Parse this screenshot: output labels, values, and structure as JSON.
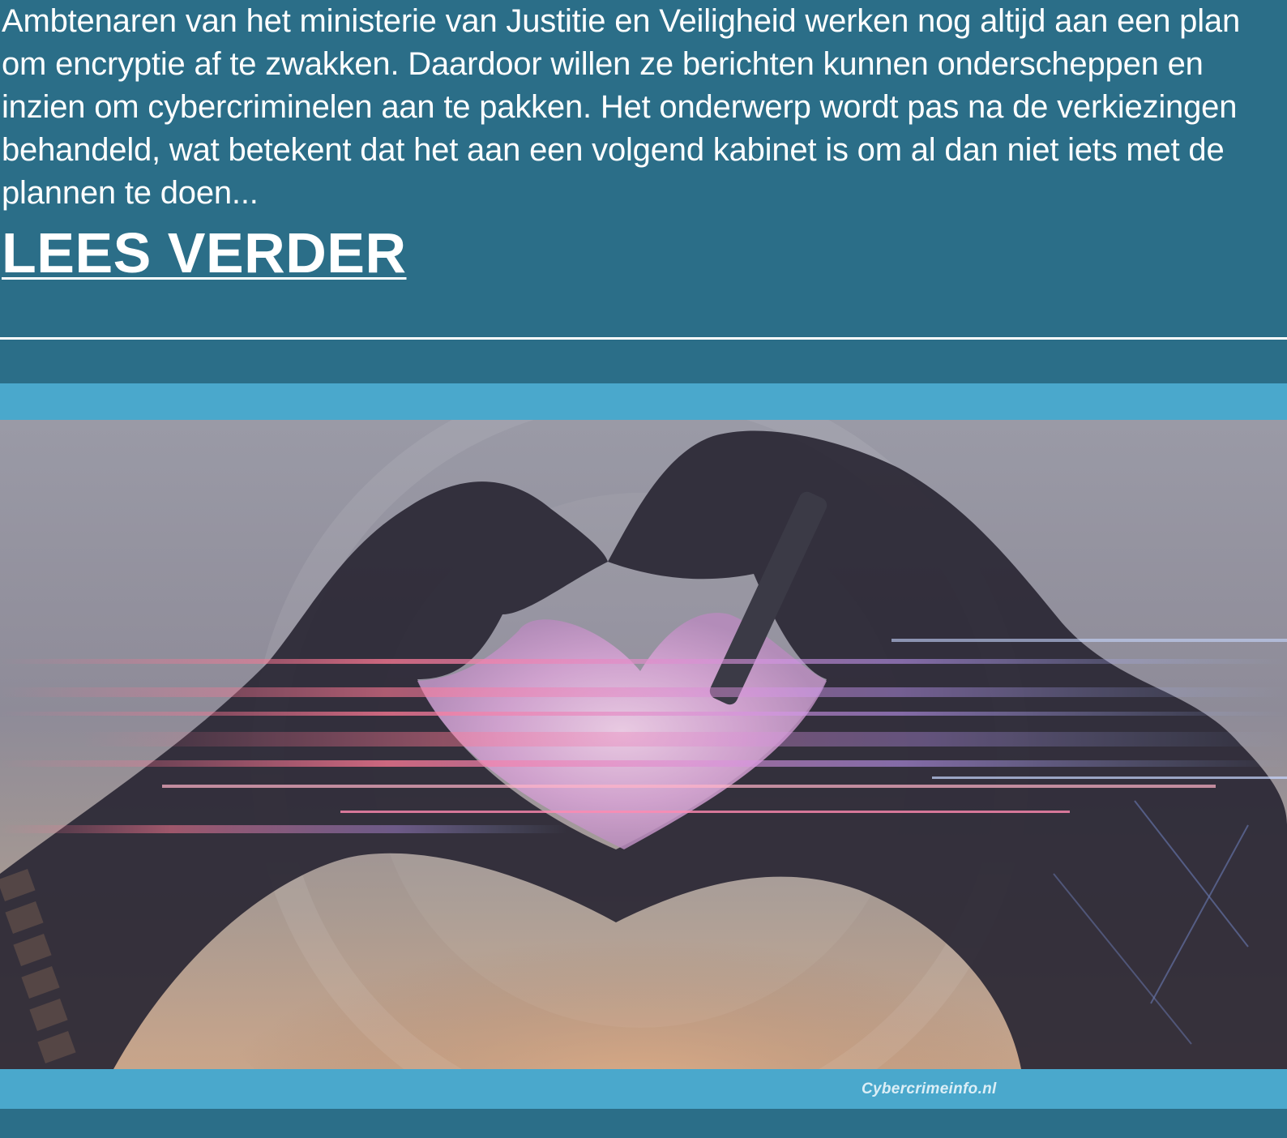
{
  "article": {
    "excerpt": "Ambtenaren van het ministerie van Justitie en Veiligheid werken nog altijd aan een plan om encryptie af te zwakken. Daardoor willen ze berichten kunnen onderscheppen en inzien om cybercriminelen aan te pakken. Het onderwerp wordt pas na de verkiezingen behandeld, wat betekent dat het aan een volgend kabinet is om al dan niet iets met de plannen te doen...",
    "read_more_label": "LEES VERDER"
  },
  "banner": {
    "watermark": "Cybercrimeinfo.nl",
    "image_subject": "heart-hands-photo"
  },
  "colors": {
    "page_background": "#2b6e88",
    "banner_frame": "#4aa8cc",
    "text": "#ffffff"
  }
}
